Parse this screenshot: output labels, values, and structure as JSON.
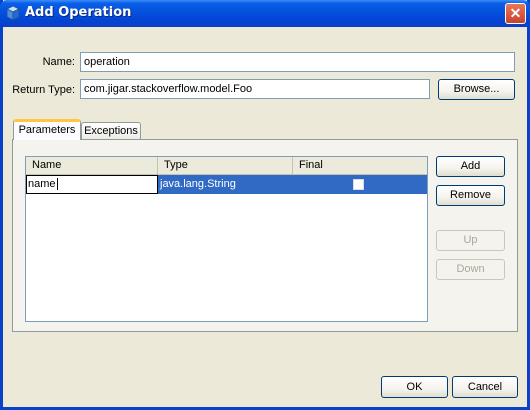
{
  "window": {
    "title": "Add Operation",
    "close_glyph": "✕",
    "app_icon": "cube-icon"
  },
  "form": {
    "name_label": "Name:",
    "name_value": "operation",
    "return_type_label": "Return Type:",
    "return_type_value": "com.jigar.stackoverflow.model.Foo",
    "browse_label": "Browse..."
  },
  "tabs": [
    {
      "label": "Parameters",
      "active": true
    },
    {
      "label": "Exceptions",
      "active": false
    }
  ],
  "table": {
    "columns": [
      "Name",
      "Type",
      "Final"
    ],
    "rows": [
      {
        "name": "name",
        "type": "java.lang.String",
        "final": false,
        "selected": true,
        "editing": true
      }
    ]
  },
  "side_buttons": {
    "add": "Add",
    "remove": "Remove",
    "up": "Up",
    "down": "Down"
  },
  "footer": {
    "ok": "OK",
    "cancel": "Cancel"
  },
  "colors": {
    "selection": "#316ac5",
    "titlebar": "#0553df",
    "active_tab_accent": "#ffc73c"
  }
}
